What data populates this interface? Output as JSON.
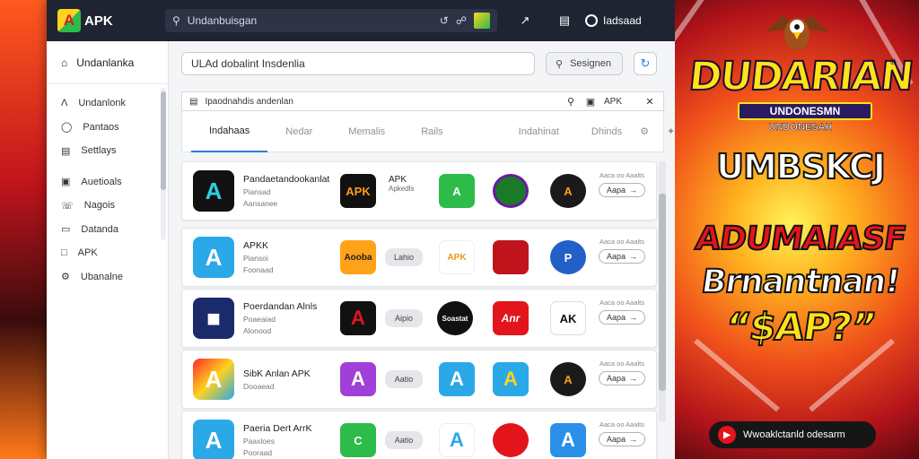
{
  "app": {
    "logo_text": "APK",
    "logo_glyph": "A"
  },
  "topbar": {
    "search_value": "Undanbuisgan",
    "user_label": "Iadsaad"
  },
  "sidebar": {
    "header": "Undanlanka",
    "items": [
      {
        "label": "Undanlonk",
        "icon": "a-icon"
      },
      {
        "label": "Pantaos",
        "icon": "bulb-icon"
      },
      {
        "label": "Settlays",
        "icon": "list-icon"
      },
      {
        "label": "Auetioals",
        "icon": "image-icon"
      },
      {
        "label": "Nagois",
        "icon": "phone-icon"
      },
      {
        "label": "Datanda",
        "icon": "monitor-icon"
      },
      {
        "label": "APK",
        "icon": "square-icon"
      },
      {
        "label": "Ubanalne",
        "icon": "gear-icon"
      }
    ]
  },
  "main": {
    "search_value": "ULAd dobalint Insdenlia",
    "search_button": "Sesignen",
    "panel_header": "Ipaodnahdis andenlan",
    "panel_header_apk": "APK",
    "tabs": [
      "Indahaas",
      "Nedar",
      "Memalis",
      "Rails",
      "Indahinat",
      "Dhinds"
    ],
    "rows": [
      {
        "title": "Pandaetandookanlat",
        "sub1": "Piansad",
        "sub2": "Aansanee",
        "pill1": "APK",
        "pill2": "Apkedls",
        "meta": "Aaca oo Aaalts",
        "btn": "Aapa"
      },
      {
        "title": "APKK",
        "sub1": "Piansoi",
        "sub2": "Foonaad",
        "pill1": "Aooba",
        "pill2": "Lahio",
        "mini3": "APK",
        "meta": "Aaca oo Aaalts",
        "btn": "Aapa"
      },
      {
        "title": "Poerdandan Alnls",
        "sub1": "Poaeaiad",
        "sub2": "Alonood",
        "pill1": "Aipio",
        "mini2": "Soastat",
        "mini3": "Anr",
        "meta": "Aaca oo Aaalts",
        "btn": "Aapa"
      },
      {
        "title": "SibK Anlan APK",
        "sub1": "Dooaead",
        "sub2": "",
        "pill1": "Aatio",
        "meta": "Aaca oo Aaalts",
        "btn": "Aapa"
      },
      {
        "title": "Paeria Dert ArrK",
        "sub1": "Paaxloes",
        "sub2": "Pooraad",
        "pill1": "Aatio",
        "meta": "Aaca oo Aaalts",
        "btn": "Aapa"
      }
    ]
  },
  "promo": {
    "brand": "DUDARIAN",
    "brand_sub": "UNDONESMN",
    "brand_sub2": "UNDONESAH",
    "line1": "UMBSKCJ",
    "line2": "ADUMAIASF",
    "line3": "Brnantnan!",
    "line4": "“$AP?”",
    "pill": "Wwoaklctanld odesarm"
  }
}
